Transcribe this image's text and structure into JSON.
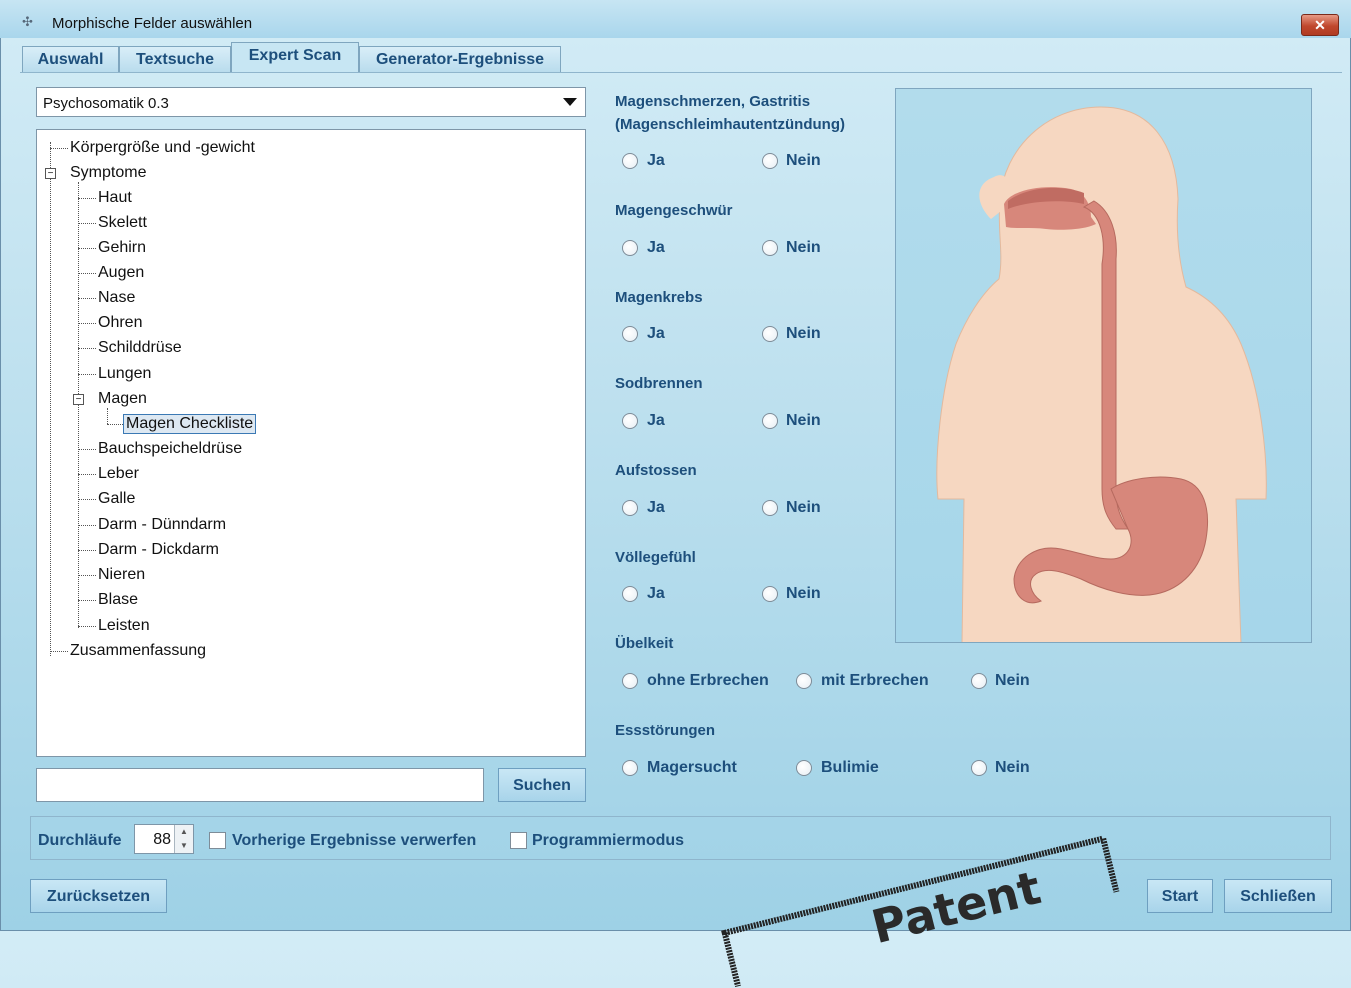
{
  "window": {
    "title": "Morphische Felder auswählen",
    "close_glyph": "✕"
  },
  "tabs": [
    {
      "label": "Auswahl",
      "active": false
    },
    {
      "label": "Textsuche",
      "active": false
    },
    {
      "label": "Expert Scan",
      "active": true
    },
    {
      "label": "Generator-Ergebnisse",
      "active": false
    }
  ],
  "profile_select": {
    "value": "Psychosomatik 0.3"
  },
  "tree": {
    "items": [
      {
        "label": "Körpergröße und -gewicht"
      },
      {
        "label": "Symptome",
        "expander": "−"
      },
      {
        "label": "Haut"
      },
      {
        "label": "Skelett"
      },
      {
        "label": "Gehirn"
      },
      {
        "label": "Augen"
      },
      {
        "label": "Nase"
      },
      {
        "label": "Ohren"
      },
      {
        "label": "Schilddrüse"
      },
      {
        "label": "Lungen"
      },
      {
        "label": "Magen",
        "expander": "−"
      },
      {
        "label": "Magen Checkliste",
        "selected": true
      },
      {
        "label": "Bauchspeicheldrüse"
      },
      {
        "label": "Leber"
      },
      {
        "label": "Galle"
      },
      {
        "label": "Darm - Dünndarm"
      },
      {
        "label": "Darm - Dickdarm"
      },
      {
        "label": "Nieren"
      },
      {
        "label": "Blase"
      },
      {
        "label": "Leisten"
      },
      {
        "label": "Zusammenfassung"
      }
    ]
  },
  "search": {
    "value": "",
    "button_label": "Suchen"
  },
  "questions": [
    {
      "label": "Magenschmerzen, Gastritis",
      "label2": "(Magenschleimhautentzündung)",
      "options": [
        "Ja",
        "Nein"
      ]
    },
    {
      "label": "Magengeschwür",
      "options": [
        "Ja",
        "Nein"
      ]
    },
    {
      "label": "Magenkrebs",
      "options": [
        "Ja",
        "Nein"
      ]
    },
    {
      "label": "Sodbrennen",
      "options": [
        "Ja",
        "Nein"
      ]
    },
    {
      "label": "Aufstossen",
      "options": [
        "Ja",
        "Nein"
      ]
    },
    {
      "label": "Völlegefühl",
      "options": [
        "Ja",
        "Nein"
      ]
    },
    {
      "label": "Übelkeit",
      "options": [
        "ohne Erbrechen",
        "mit Erbrechen",
        "Nein"
      ]
    },
    {
      "label": "Essstörungen",
      "options": [
        "Magersucht",
        "Bulimie",
        "Nein"
      ]
    }
  ],
  "illustration": {
    "name": "digestive-tract-illustration",
    "colors": {
      "skin": "#f6d7c1",
      "organ": "#d7877b"
    }
  },
  "options_bar": {
    "runs_label": "Durchläufe",
    "runs_value": "88",
    "discard_label": "Vorherige Ergebnisse verwerfen",
    "discard_checked": false,
    "program_label": "Programmiermodus",
    "program_checked": false
  },
  "footer": {
    "reset_label": "Zurücksetzen",
    "start_label": "Start",
    "close_label": "Schließen"
  },
  "stamp": {
    "text": "Patent"
  },
  "colors": {
    "accent": "#1d4f7c",
    "background": "#bfe1ef"
  }
}
